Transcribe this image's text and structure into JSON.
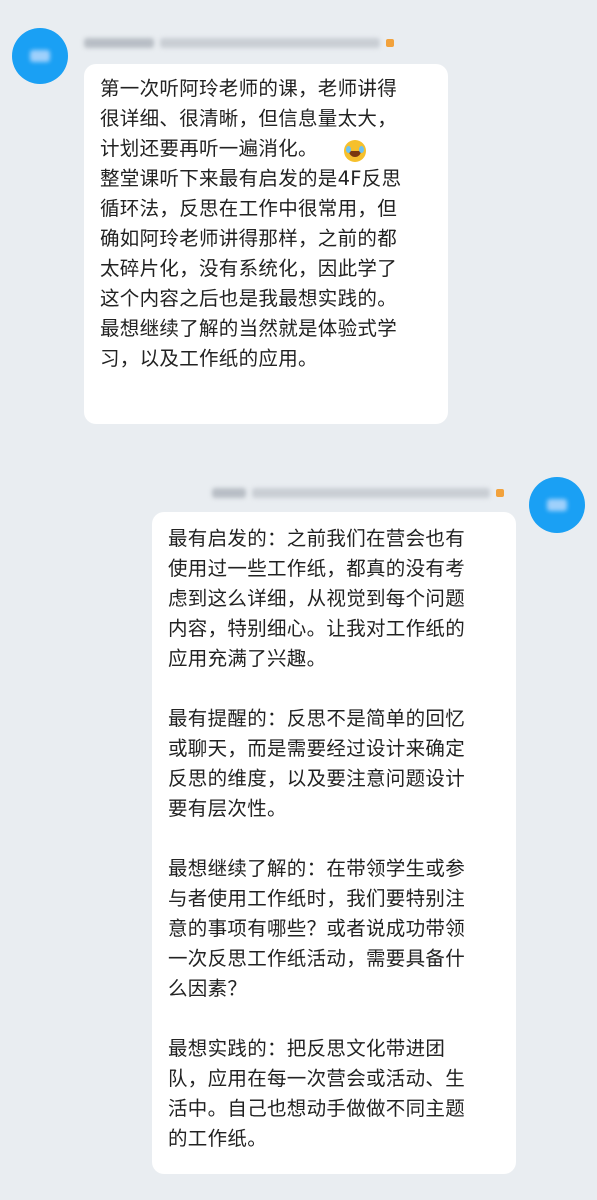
{
  "messages": [
    {
      "side": "left",
      "avatar_icon": "user-avatar-icon",
      "sender_name": "",
      "group_tag": "",
      "lines_before_emoji": "第一次听阿玲老师的课，老师讲得\n很详细、很清晰，但信息量太大，\n计划还要再听一遍消化。",
      "emoji": "laugh-cry-emoji",
      "lines_after_emoji": "整堂课听下来最有启发的是4F反思\n循环法，反思在工作中很常用，但\n确如阿玲老师讲得那样，之前的都\n太碎片化，没有系统化，因此学了\n这个内容之后也是我最想实践的。\n最想继续了解的当然就是体验式学\n习，以及工作纸的应用。"
    },
    {
      "side": "right",
      "avatar_icon": "user-avatar-icon",
      "sender_name": "",
      "group_tag": "",
      "paragraphs": [
        "最有启发的：之前我们在营会也有\n使用过一些工作纸，都真的没有考\n虑到这么详细，从视觉到每个问题\n内容，特别细心。让我对工作纸的\n应用充满了兴趣。",
        "最有提醒的：反思不是简单的回忆\n或聊天，而是需要经过设计来确定\n反思的维度，以及要注意问题设计\n要有层次性。",
        "最想继续了解的：在带领学生或参\n与者使用工作纸时，我们要特别注\n意的事项有哪些？或者说成功带领\n一次反思工作纸活动，需要具备什\n么因素？",
        "最想实践的：把反思文化带进团\n队，应用在每一次营会或活动、生\n活中。自己也想动手做做不同主题\n的工作纸。"
      ]
    }
  ],
  "colors": {
    "background": "#e9edf1",
    "bubble": "#ffffff",
    "avatar": "#1aa0f4",
    "badge": "#f2a23c",
    "text": "#222222"
  }
}
